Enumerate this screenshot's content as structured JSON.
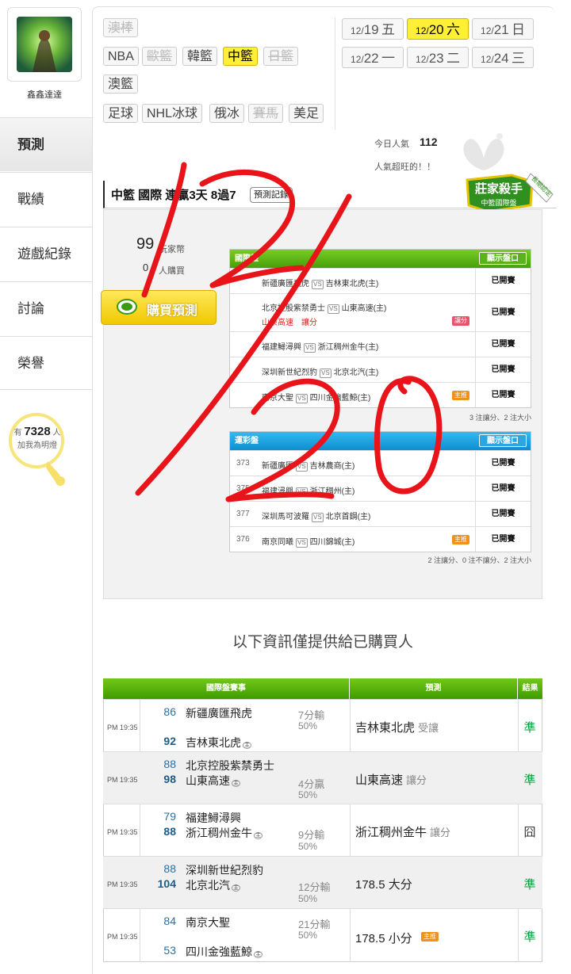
{
  "user": {
    "name": "鑫鑫達達"
  },
  "nav": [
    {
      "label": "預測"
    },
    {
      "label": "戰績"
    },
    {
      "label": "遊戲紀錄"
    },
    {
      "label": "討論"
    },
    {
      "label": "榮譽"
    }
  ],
  "fans": {
    "prefix": "有",
    "count": "7328",
    "suffix": "人",
    "cta": "加我為明燈"
  },
  "sports_tags": [
    {
      "label": "澳棒",
      "state": "disabled"
    },
    {
      "label": "NBA",
      "state": "normal"
    },
    {
      "label": "歐籃",
      "state": "disabled"
    },
    {
      "label": "韓籃",
      "state": "normal"
    },
    {
      "label": "中籃",
      "state": "selected"
    },
    {
      "label": "日籃",
      "state": "disabled"
    },
    {
      "label": "澳籃",
      "state": "normal"
    },
    {
      "label": "足球",
      "state": "normal"
    },
    {
      "label": "NHL冰球",
      "state": "normal"
    },
    {
      "label": "俄冰",
      "state": "normal"
    },
    {
      "label": "賽馬",
      "state": "disabled"
    },
    {
      "label": "美足",
      "state": "normal"
    }
  ],
  "dates": [
    {
      "md": "12/",
      "day": "19",
      "wd": "五",
      "selected": false
    },
    {
      "md": "12/",
      "day": "20",
      "wd": "六",
      "selected": true
    },
    {
      "md": "12/",
      "day": "21",
      "wd": "日",
      "selected": false
    },
    {
      "md": "12/",
      "day": "22",
      "wd": "一",
      "selected": false
    },
    {
      "md": "12/",
      "day": "23",
      "wd": "二",
      "selected": false
    },
    {
      "md": "12/",
      "day": "24",
      "wd": "三",
      "selected": false
    }
  ],
  "popularity": {
    "label": "今日人氣",
    "value": "112",
    "note": "人氣超旺的！！"
  },
  "title": {
    "text": "中籃 國際 連贏3天 8過7",
    "button": "預測記錄"
  },
  "badge": {
    "line1": "莊家殺手",
    "line2": "中籃國際盤",
    "ribbon": "長期認定"
  },
  "purchase": {
    "coins": "99",
    "coins_label": "玩家幣",
    "buyers": "0",
    "buyers_label": "人購買",
    "button": "購買預測"
  },
  "intl": {
    "header": "國際盤",
    "show": "顯示盤口",
    "rows": [
      {
        "num": "",
        "away": "新疆廣匯飛虎",
        "home": "吉林東北虎(主)",
        "extra": "",
        "tag": "",
        "status": "已開賽"
      },
      {
        "num": "",
        "away": "北京控股紫禁勇士",
        "home": "山東高速(主)",
        "extra": "山東高速　讓分",
        "tag": "讓分",
        "status": "已開賽"
      },
      {
        "num": "",
        "away": "福建鱘潯興",
        "home": "浙江稠州金牛(主)",
        "extra": "",
        "tag": "",
        "status": "已開賽"
      },
      {
        "num": "",
        "away": "深圳新世紀烈豹",
        "home": "北京北汽(主)",
        "extra": "",
        "tag": "",
        "status": "已開賽"
      },
      {
        "num": "",
        "away": "南京大聖",
        "home": "四川金強藍鯨(主)",
        "extra": "",
        "tag": "主推",
        "status": "已開賽"
      }
    ],
    "footnote": "3 注讓分、2 注大小"
  },
  "lottery": {
    "header": "運彩盤",
    "show": "顯示盤口",
    "rows": [
      {
        "num": "373",
        "away": "新疆廣匯",
        "home": "吉林農商(主)",
        "tag": "",
        "status": "已開賽"
      },
      {
        "num": "375",
        "away": "福建潯興",
        "home": "浙江稠州(主)",
        "tag": "",
        "status": "已開賽"
      },
      {
        "num": "377",
        "away": "深圳馬可波羅",
        "home": "北京首鋼(主)",
        "tag": "",
        "status": "已開賽"
      },
      {
        "num": "376",
        "away": "南京同曦",
        "home": "四川錦城(主)",
        "tag": "主推",
        "status": "已開賽"
      }
    ],
    "footnote": "2 注讓分、0 注不讓分、2 注大小"
  },
  "only_note": "以下資訊僅提供給已購買人",
  "results": {
    "headers": [
      "國際盤賽事",
      "預測",
      "結果"
    ],
    "rows": [
      {
        "time": "PM 19:35",
        "s1": "86",
        "t1": "新疆廣匯飛虎",
        "s2": "92",
        "t2": "吉林東北虎",
        "margin": "7分輸",
        "pct": "50%",
        "pick": "吉林東北虎",
        "pick_type": "受讓",
        "result": "準"
      },
      {
        "time": "PM 19:35",
        "s1": "88",
        "t1": "北京控股紫禁勇士",
        "s2": "98",
        "t2": "山東高速",
        "margin": "4分贏",
        "pct": "50%",
        "pick": "山東高速",
        "pick_type": "讓分",
        "result": "準"
      },
      {
        "time": "PM 19:35",
        "s1": "79",
        "t1": "福建鱘潯興",
        "s2": "88",
        "t2": "浙江稠州金牛",
        "margin": "9分輸",
        "pct": "50%",
        "pick": "浙江稠州金牛",
        "pick_type": "讓分",
        "result": "囧"
      },
      {
        "time": "PM 19:35",
        "s1": "88",
        "t1": "深圳新世紀烈豹",
        "s2": "104",
        "t2": "北京北汽",
        "margin": "12分輸",
        "pct": "50%",
        "pick": "178.5 大分",
        "pick_type": "",
        "result": "準"
      },
      {
        "time": "PM 19:35",
        "s1": "84",
        "t1": "南京大聖",
        "s2": "53",
        "t2": "四川金強藍鯨",
        "margin": "21分輸",
        "pct": "50%",
        "pick": "178.5 小分",
        "pick_type": "主推",
        "result": "準"
      }
    ]
  },
  "colors": {
    "green": "#4aa80a",
    "blue": "#1ea3e0",
    "yellow": "#ffef37",
    "ink": "#e8141a"
  },
  "overlay_icon": "handwritten-date"
}
